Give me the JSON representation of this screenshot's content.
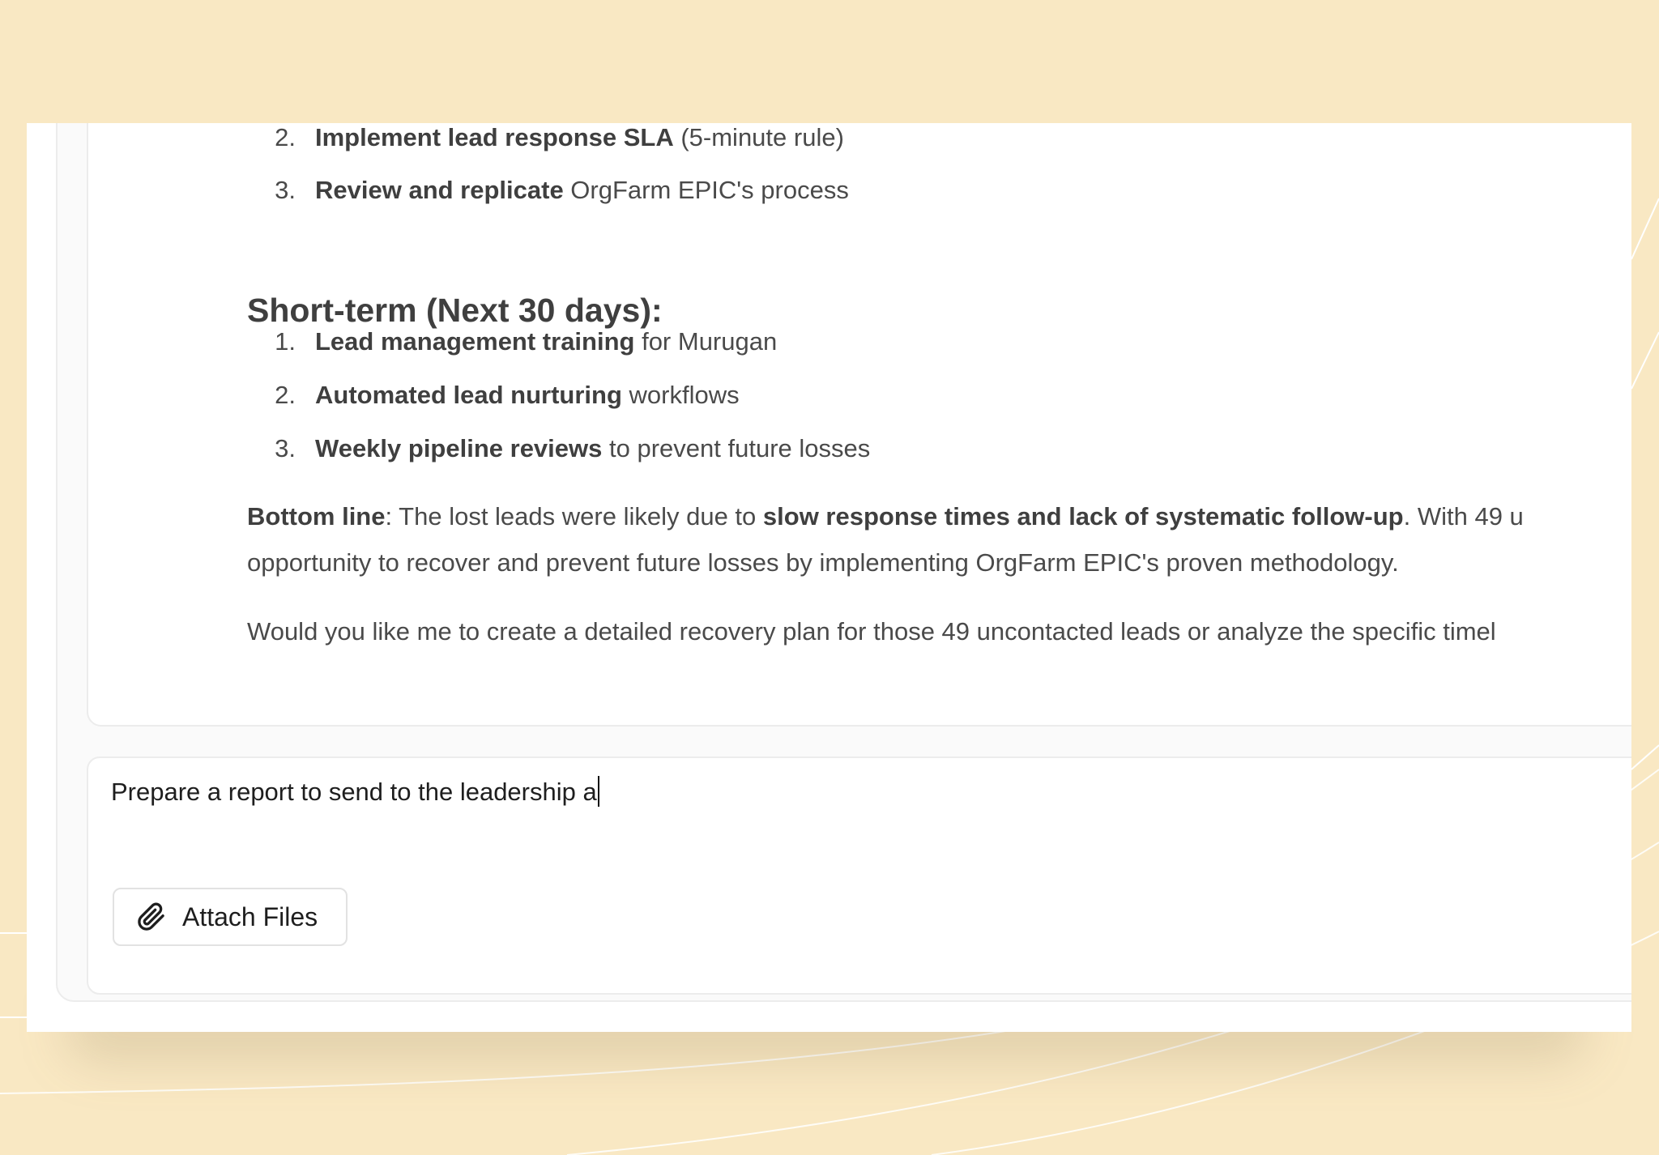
{
  "message": {
    "immediate_items": [
      {
        "num": "2.",
        "bold": "Implement lead response SLA",
        "rest": " (5-minute rule)"
      },
      {
        "num": "3.",
        "bold": "Review and replicate",
        "rest": " OrgFarm EPIC's process"
      }
    ],
    "short_term_heading": "Short-term (Next 30 days):",
    "short_term_items": [
      {
        "num": "1.",
        "bold": "Lead management training",
        "rest": " for Murugan"
      },
      {
        "num": "2.",
        "bold": "Automated lead nurturing",
        "rest": " workflows"
      },
      {
        "num": "3.",
        "bold": "Weekly pipeline reviews",
        "rest": " to prevent future losses"
      }
    ],
    "bottom_line": {
      "label": "Bottom line",
      "text1": ": The lost leads were likely due to ",
      "bold2": "slow response times and lack of systematic follow-up",
      "text2": ". With 49 u",
      "line2": "opportunity to recover and prevent future losses by implementing OrgFarm EPIC's proven methodology."
    },
    "followup": "Would you like me to create a detailed recovery plan for those 49 uncontacted leads or analyze the specific timel"
  },
  "composer": {
    "value": "Prepare a report to send to the leadership a",
    "attach_label": "Attach Files"
  },
  "icons": {
    "attach": "paperclip-icon"
  },
  "colors": {
    "background": "#f9e8c3",
    "text": "#4a4a4a",
    "border": "#ececec"
  }
}
